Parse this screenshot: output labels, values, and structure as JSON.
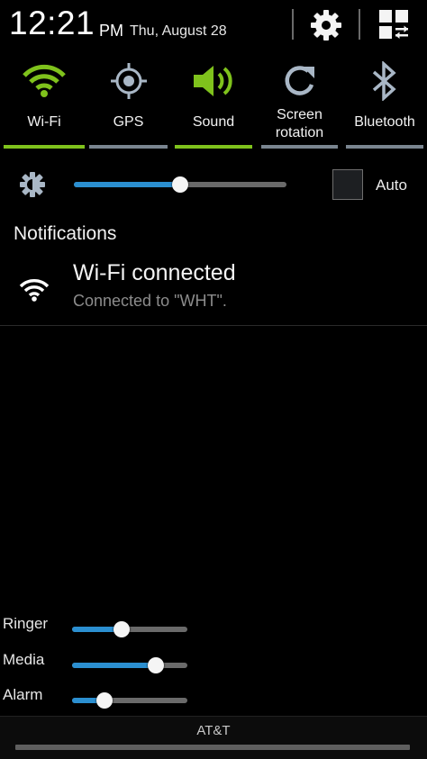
{
  "status": {
    "time": "12:21",
    "ampm": "PM",
    "date": "Thu, August 28",
    "settings_icon": "gear-icon",
    "grid_icon": "grid-edit-icon"
  },
  "toggles": [
    {
      "label": "Wi-Fi",
      "icon": "wifi-icon",
      "active": true
    },
    {
      "label": "GPS",
      "icon": "gps-icon",
      "active": false
    },
    {
      "label": "Sound",
      "icon": "sound-icon",
      "active": true
    },
    {
      "label": "Screen rotation",
      "label_line1": "Screen",
      "label_line2": "rotation",
      "icon": "rotation-icon",
      "active": false
    },
    {
      "label": "Bluetooth",
      "icon": "bluetooth-icon",
      "active": false
    }
  ],
  "colors": {
    "active_green": "#7fc21c",
    "inactive_bar": "#7a8590",
    "slider_blue": "#2b8fd0",
    "icon_inactive": "#a9b7c6"
  },
  "brightness": {
    "level": 0.5,
    "auto_label": "Auto",
    "auto_checked": false
  },
  "notifications": {
    "header": "Notifications",
    "items": [
      {
        "icon": "wifi-icon",
        "title": "Wi-Fi connected",
        "subtitle": "Connected to \"WHT\"."
      }
    ]
  },
  "volume": [
    {
      "label": "Ringer",
      "level": 0.43
    },
    {
      "label": "Media",
      "level": 0.73
    },
    {
      "label": "Alarm",
      "level": 0.28
    }
  ],
  "footer": {
    "carrier": "AT&T"
  }
}
